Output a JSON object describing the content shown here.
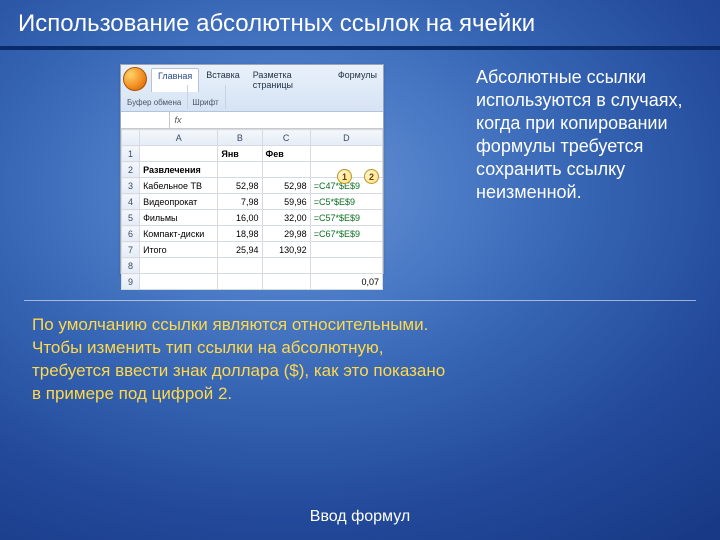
{
  "title": "Использование абсолютных ссылок на ячейки",
  "ribbon": {
    "tabs": [
      "Главная",
      "Вставка",
      "Разметка страницы",
      "Формулы"
    ],
    "group_clipboard": "Буфер обмена",
    "group_font": "Шрифт"
  },
  "formula_bar": {
    "namebox": "",
    "fx": "fx"
  },
  "grid": {
    "col_headers": [
      "",
      "A",
      "B",
      "C",
      "D"
    ],
    "rows": [
      {
        "n": "1",
        "a": "",
        "b": "Янв",
        "c": "Фев",
        "d": ""
      },
      {
        "n": "2",
        "a": "Развлечения",
        "b": "",
        "c": "",
        "d": ""
      },
      {
        "n": "3",
        "a": "Кабельное ТВ",
        "b": "52,98",
        "c": "52,98",
        "d": "=C47*$E$9"
      },
      {
        "n": "4",
        "a": "Видеопрокат",
        "b": "7,98",
        "c": "59,96",
        "d": "=C5*$E$9"
      },
      {
        "n": "5",
        "a": "Фильмы",
        "b": "16,00",
        "c": "32,00",
        "d": "=C57*$E$9"
      },
      {
        "n": "6",
        "a": "Компакт-диски",
        "b": "18,98",
        "c": "29,98",
        "d": "=C67*$E$9"
      },
      {
        "n": "7",
        "a": "Итого",
        "b": "25,94",
        "c": "130,92",
        "d": ""
      },
      {
        "n": "8",
        "a": "",
        "b": "",
        "c": "",
        "d": ""
      },
      {
        "n": "9",
        "a": "",
        "b": "",
        "c": "",
        "d": "0,07"
      }
    ]
  },
  "callouts": {
    "one": "1",
    "two": "2"
  },
  "right_text": "Абсолютные ссылки используются в случаях, когда при копировании формулы требуется сохранить ссылку неизменной.",
  "bottom_text_lines": [
    "По умолчанию ссылки являются относительными.",
    "Чтобы изменить тип ссылки на абсолютную,",
    "требуется ввести знак доллара ($), как это показано",
    "в примере под цифрой 2."
  ],
  "footer": "Ввод формул"
}
